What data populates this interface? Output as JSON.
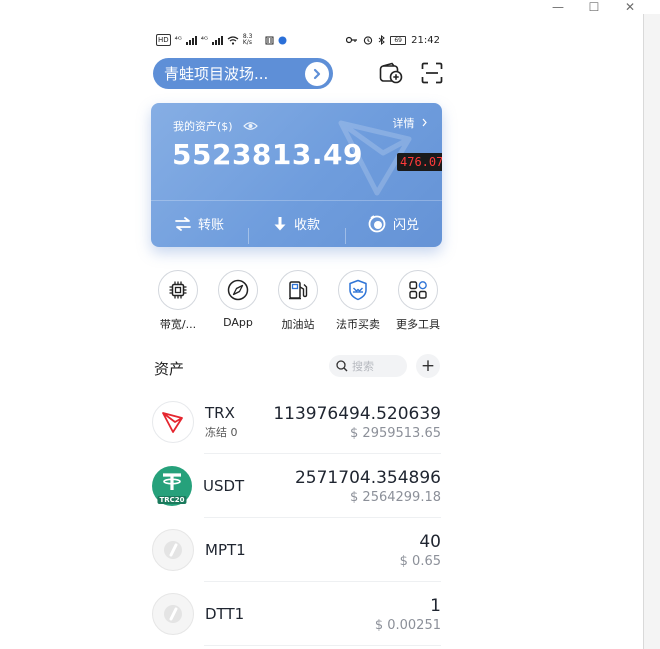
{
  "window": {
    "controls": [
      "—",
      "☐",
      "✕"
    ]
  },
  "status_bar": {
    "left_items": [
      "HD",
      "⁴ᴳ",
      "⁴ᴳ",
      "8.3 K/s"
    ],
    "time": "21:42",
    "battery": "69"
  },
  "header": {
    "wallet_name": "青蛙项目波场..."
  },
  "balance_card": {
    "label": "我的资产($)",
    "detail": "详情",
    "amount": "5523813.49",
    "overlay_tag": "476.07",
    "actions": [
      {
        "label": "转账",
        "icon": "transfer-icon"
      },
      {
        "label": "收款",
        "icon": "receive-icon"
      },
      {
        "label": "闪兑",
        "icon": "swap-icon"
      }
    ]
  },
  "tools": [
    {
      "label": "带宽/...",
      "icon": "chip-icon"
    },
    {
      "label": "DApp",
      "icon": "compass-icon"
    },
    {
      "label": "加油站",
      "icon": "gas-station-icon"
    },
    {
      "label": "法币买卖",
      "icon": "shield-exchange-icon"
    },
    {
      "label": "更多工具",
      "icon": "grid-icon"
    }
  ],
  "assets": {
    "title": "资产",
    "search_placeholder": "搜索",
    "add_label": "+",
    "items": [
      {
        "symbol": "TRX",
        "sub": "冻结 0",
        "amount": "113976494.520639",
        "value": "$ 2959513.65"
      },
      {
        "symbol": "USDT",
        "sub": "",
        "amount": "2571704.354896",
        "value": "$ 2564299.18",
        "icon_text": "TRC20"
      },
      {
        "symbol": "MPT1",
        "sub": "",
        "amount": "40",
        "value": "$ 0.65"
      },
      {
        "symbol": "DTT1",
        "sub": "",
        "amount": "1",
        "value": "$ 0.00251"
      }
    ]
  },
  "colors": {
    "accent": "#5e8fd7",
    "card": "#6f9ddd",
    "tron_red": "#e5262f",
    "usdt_green": "#26a17b"
  }
}
